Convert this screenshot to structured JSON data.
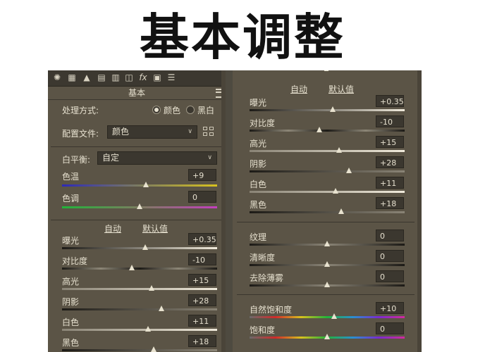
{
  "title": "基本调整",
  "left": {
    "section_title": "基本",
    "processing": {
      "label": "处理方式:",
      "options": [
        "颜色",
        "黑白"
      ],
      "selected": "颜色"
    },
    "profile": {
      "label": "配置文件:",
      "value": "颜色"
    },
    "white_balance": {
      "label": "白平衡:",
      "value": "自定"
    },
    "temperature": {
      "label": "色温",
      "value": "+9",
      "position": 0.54
    },
    "tint": {
      "label": "色调",
      "value": "0",
      "position": 0.5
    },
    "auto_label": "自动",
    "default_label": "默认值",
    "sliders": [
      {
        "label": "曝光",
        "value": "+0.35",
        "position": 0.535
      },
      {
        "label": "对比度",
        "value": "-10",
        "position": 0.45
      },
      {
        "label": "高光",
        "value": "+15",
        "position": 0.575
      },
      {
        "label": "阴影",
        "value": "+28",
        "position": 0.64
      },
      {
        "label": "白色",
        "value": "+11",
        "position": 0.555
      },
      {
        "label": "黑色",
        "value": "+18",
        "position": 0.59
      }
    ]
  },
  "right": {
    "auto_label": "自动",
    "default_label": "默认值",
    "tone_sliders": [
      {
        "label": "曝光",
        "value": "+0.35",
        "position": 0.535
      },
      {
        "label": "对比度",
        "value": "-10",
        "position": 0.45
      },
      {
        "label": "高光",
        "value": "+15",
        "position": 0.575
      },
      {
        "label": "阴影",
        "value": "+28",
        "position": 0.64
      },
      {
        "label": "白色",
        "value": "+11",
        "position": 0.555
      },
      {
        "label": "黑色",
        "value": "+18",
        "position": 0.59
      }
    ],
    "presence_sliders": [
      {
        "label": "纹理",
        "value": "0",
        "position": 0.5
      },
      {
        "label": "清晰度",
        "value": "0",
        "position": 0.5
      },
      {
        "label": "去除薄雾",
        "value": "0",
        "position": 0.5
      }
    ],
    "color_sliders": [
      {
        "label": "自然饱和度",
        "value": "+10",
        "position": 0.545
      },
      {
        "label": "饱和度",
        "value": "0",
        "position": 0.5
      }
    ]
  },
  "toolbar_icons": [
    "aperture-icon",
    "grid-icon",
    "mountain-icon",
    "split-icon",
    "lens-icon",
    "fx-icon",
    "calibration-icon",
    "sliders-icon"
  ],
  "colors": {
    "panel": "#5b5446",
    "field": "#3b372f",
    "text": "#e6e0cf"
  }
}
